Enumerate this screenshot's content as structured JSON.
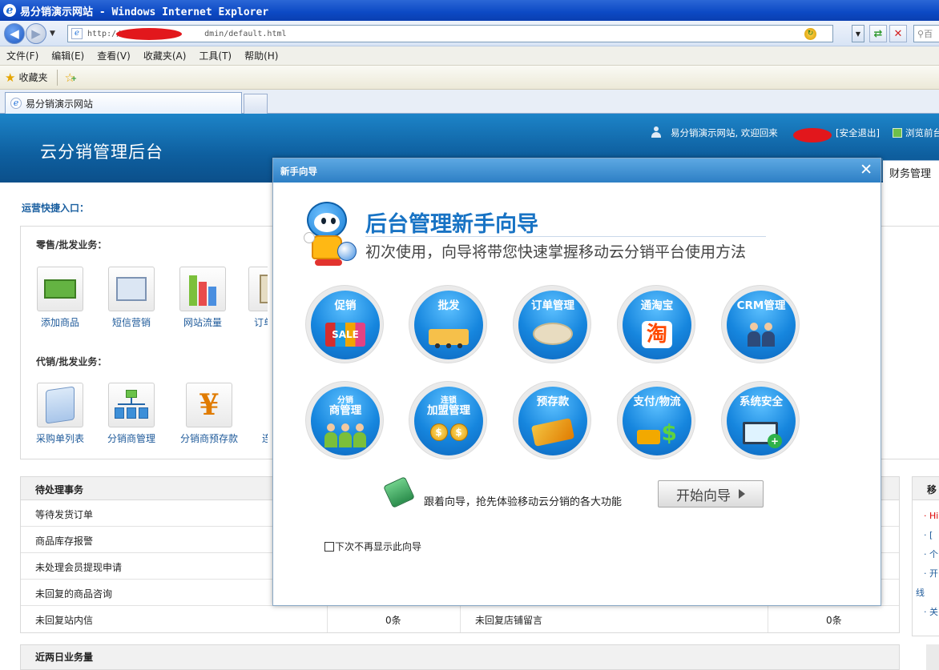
{
  "browser": {
    "window_title": "易分销演示网站 - Windows Internet Explorer",
    "address_prefix": "http://",
    "address_suffix": "dmin/default.html",
    "search_placeholder": "百",
    "menu": [
      "文件(F)",
      "编辑(E)",
      "查看(V)",
      "收藏夹(A)",
      "工具(T)",
      "帮助(H)"
    ],
    "favorites_label": "收藏夹",
    "tab_title": "易分销演示网站"
  },
  "header": {
    "title": "云分销管理后台",
    "welcome": "易分销演示网站, 欢迎回来",
    "logout": "[安全退出]",
    "browse_front": "浏览前台",
    "nav_visible_tab": "财务管理"
  },
  "quick": {
    "title": "运营快捷入口：",
    "retail_label": "零售/批发业务：",
    "retail_items": [
      "添加商品",
      "短信营销",
      "网站流量",
      "订单"
    ],
    "agency_label": "代销/批发业务：",
    "agency_items": [
      "采购单列表",
      "分销商管理",
      "分销商预存款",
      "连锁"
    ]
  },
  "pending": {
    "title": "待处理事务",
    "rows": [
      {
        "label": "等待发货订单",
        "value": "",
        "label2": "",
        "value2": ""
      },
      {
        "label": "商品库存报警",
        "value": "",
        "label2": "",
        "value2": ""
      },
      {
        "label": "未处理会员提现申请",
        "value": "",
        "label2": "",
        "value2": ""
      },
      {
        "label": "未回复的商品咨询",
        "value": "",
        "label2": "",
        "value2": ""
      },
      {
        "label": "未回复站内信",
        "value": "0条",
        "label2": "未回复店铺留言",
        "value2": "0条"
      }
    ]
  },
  "recent": {
    "title": "近两日业务量"
  },
  "side": {
    "title": "移",
    "items": [
      "· Hi",
      "· [",
      "· 个",
      "· 开",
      "线",
      "· 关"
    ]
  },
  "wizard": {
    "bar_title": "新手向导",
    "close": "✕",
    "title": "后台管理新手向导",
    "subtitle": "初次使用，向导将带您快速掌握移动云分销平台使用方法",
    "features": [
      {
        "label": "促销",
        "small": "",
        "art": "SALE"
      },
      {
        "label": "批发",
        "small": "",
        "art": ""
      },
      {
        "label": "订单管理",
        "small": "",
        "art": ""
      },
      {
        "label": "通淘宝",
        "small": "",
        "art": "淘"
      },
      {
        "label": "CRM管理",
        "small": "",
        "art": ""
      },
      {
        "label": "商管理",
        "small": "分销",
        "art": ""
      },
      {
        "label": "加盟管理",
        "small": "连锁",
        "art": "$"
      },
      {
        "label": "预存款",
        "small": "",
        "art": ""
      },
      {
        "label": "支付/物流",
        "small": "",
        "art": "$"
      },
      {
        "label": "系统安全",
        "small": "",
        "art": ""
      }
    ],
    "cta_text": "跟着向导，抢先体验移动云分销的各大功能",
    "start_button": "开始向导",
    "dont_show": "下次不再显示此向导"
  },
  "colors": {
    "header_blue": "#0e5f9f",
    "wizard_blue": "#1873c4",
    "redaction": "#e2171c"
  }
}
